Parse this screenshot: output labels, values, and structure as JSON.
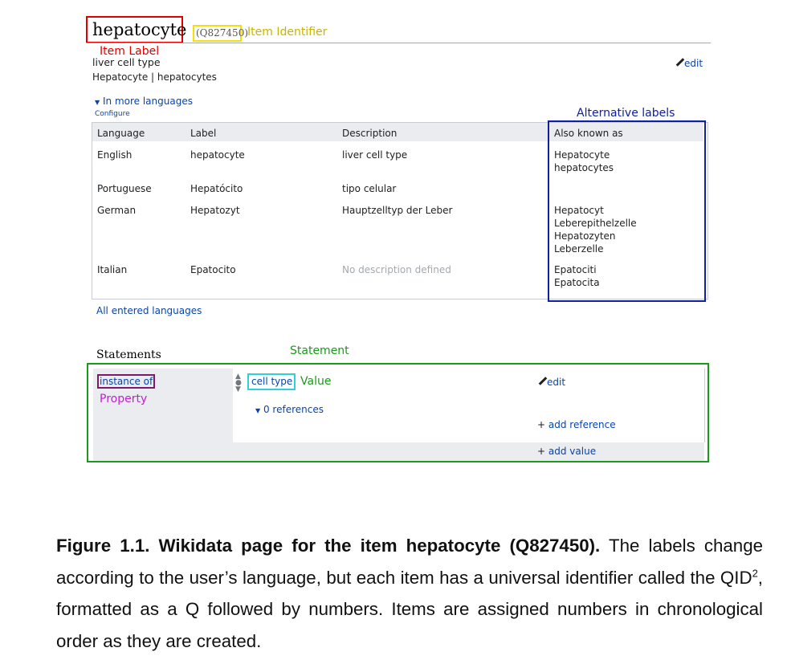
{
  "item": {
    "label": "hepatocyte",
    "qid": "(Q827450)",
    "description": "liver cell type",
    "aliases_line": "Hepatocyte | hepatocytes",
    "edit": "edit"
  },
  "annotations": {
    "item_identifier": "Item Identifier",
    "item_label": "Item Label",
    "alternative_labels": "Alternative labels",
    "statement": "Statement",
    "value": "Value",
    "property": "Property"
  },
  "languages": {
    "toggle": "In more languages",
    "configure": "Configure",
    "headers": [
      "Language",
      "Label",
      "Description",
      "Also known as"
    ],
    "rows": [
      {
        "language": "English",
        "label": "hepatocyte",
        "description": "liver cell type",
        "aliases": [
          "Hepatocyte",
          "hepatocytes"
        ]
      },
      {
        "language": "Portuguese",
        "label": "Hepatócito",
        "description": "tipo celular",
        "aliases": []
      },
      {
        "language": "German",
        "label": "Hepatozyt",
        "description": "Hauptzelltyp der Leber",
        "aliases": [
          "Hepatocyt",
          "Leberepithelzelle",
          "Hepatozyten",
          "Leberzelle"
        ]
      },
      {
        "language": "Italian",
        "label": "Epatocito",
        "description": "No description defined",
        "aliases": [
          "Epatociti",
          "Epatocita"
        ]
      }
    ],
    "all_entered": "All entered languages"
  },
  "statements": {
    "heading": "Statements",
    "property": "instance of",
    "value": "cell type",
    "edit": "edit",
    "references": "0 references",
    "add_reference": "add reference",
    "add_value": "add value"
  },
  "caption": {
    "bold": "Figure 1.1. Wikidata page for the item hepatocyte (Q827450).",
    "text1": " The labels change according to the user’s language, but each item has a universal identifier called the QID",
    "sup": "2",
    "text2": ", formatted as a Q followed by numbers. Items are assigned numbers in chronological order as they are created."
  },
  "colors": {
    "label_box": "#e00000",
    "identifier_box": "#f0e010",
    "identifier_text": "#c8b400",
    "alt_box": "#1020a0",
    "statement_box": "#1a9a1a",
    "property_box": "#7a1a6a",
    "property_text": "#c020d0",
    "value_box": "#30d0d8"
  }
}
